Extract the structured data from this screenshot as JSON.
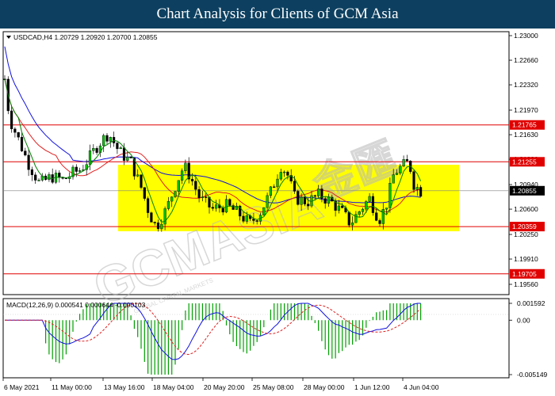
{
  "header": {
    "title": "Chart Analysis for Clients of GCM Asia"
  },
  "chart": {
    "symbol_info": "USDCAD,H4  1.20729 1.20920 1.20700 1.20855",
    "price_ticks": [
      "1.23000",
      "1.22660",
      "1.22320",
      "1.21970",
      "1.21630",
      "1.21290",
      "1.20940",
      "1.20600",
      "1.20250",
      "1.19910",
      "1.19560"
    ],
    "price_labels": [
      {
        "value": "1.21765",
        "color": "#e00000",
        "text_color": "#ffffff"
      },
      {
        "value": "1.21255",
        "color": "#e00000",
        "text_color": "#ffffff"
      },
      {
        "value": "1.20855",
        "color": "#000000",
        "text_color": "#ffffff"
      },
      {
        "value": "1.20359",
        "color": "#e00000",
        "text_color": "#ffffff"
      },
      {
        "value": "1.19705",
        "color": "#e00000",
        "text_color": "#ffffff"
      }
    ],
    "date_ticks": [
      "6 May 2021",
      "11 May 00:00",
      "13 May 16:00",
      "18 May 04:00",
      "20 May 20:00",
      "25 May 08:00",
      "28 May 00:00",
      "1 Jun 12:00",
      "4 Jun 04:00"
    ],
    "watermark": "GCMASIA",
    "watermark_sub": "GLOBAL CAPITAL MARKETS",
    "zone_color": "#ffff00"
  },
  "macd": {
    "label": "MACD(12,26,9) 0.000541 0.000644 -0.000103",
    "ticks": [
      "0.001592",
      "0.00",
      "-0.005149"
    ]
  },
  "chart_data": {
    "type": "candlestick",
    "title": "USDCAD,H4",
    "x": [
      "6 May 2021",
      "11 May 00:00",
      "13 May 16:00",
      "18 May 04:00",
      "20 May 20:00",
      "25 May 08:00",
      "28 May 00:00",
      "1 Jun 12:00",
      "4 Jun 04:00"
    ],
    "ylim": [
      1.1956,
      1.23
    ],
    "last_bar": {
      "open": 1.20729,
      "high": 1.2092,
      "low": 1.207,
      "close": 1.20855
    },
    "horizontal_levels": [
      1.21765,
      1.21255,
      1.20359,
      1.19705
    ],
    "current_price": 1.20855,
    "macd": {
      "params": "12,26,9",
      "main": 0.000541,
      "signal": 0.000644,
      "histogram": -0.000103,
      "ylim": [
        -0.005149,
        0.001592
      ]
    }
  }
}
